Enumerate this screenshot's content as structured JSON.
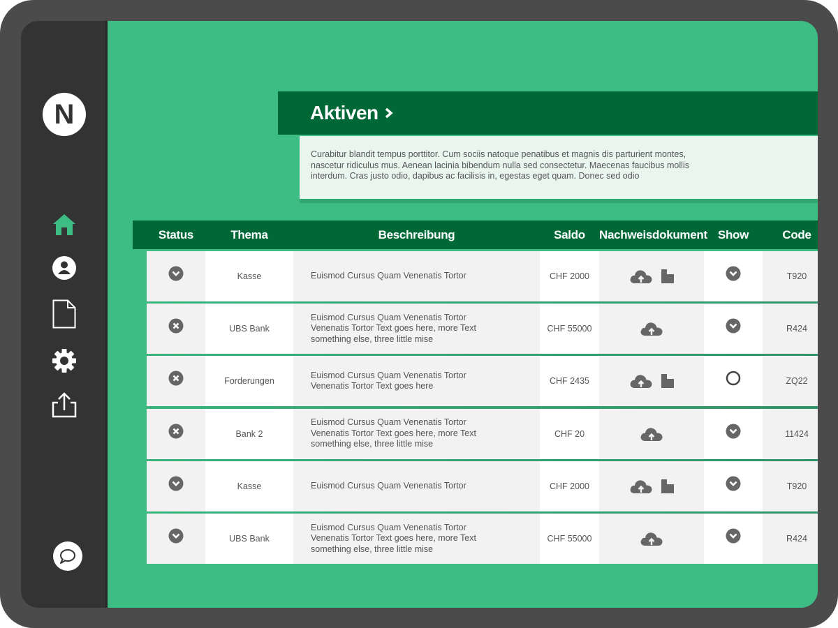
{
  "sidebar": {
    "logo_letter": "N",
    "items": [
      {
        "icon": "home-icon",
        "active": true
      },
      {
        "icon": "user-icon",
        "active": false
      },
      {
        "icon": "document-icon",
        "active": false
      },
      {
        "icon": "gear-icon",
        "active": false
      },
      {
        "icon": "share-icon",
        "active": false
      }
    ],
    "chat_icon": "chat-icon"
  },
  "header": {
    "title": "Aktiven",
    "description": "Curabitur blandit tempus porttitor. Cum sociis natoque penatibus et magnis dis parturient montes, nascetur ridiculus mus. Aenean lacinia bibendum nulla sed consectetur. Maecenas faucibus mollis interdum. Cras justo odio, dapibus ac facilisis in, egestas eget quam. Donec sed odio"
  },
  "table": {
    "columns": [
      "Status",
      "Thema",
      "Beschreibung",
      "Saldo",
      "Nachweisdokument",
      "Show",
      "Code"
    ],
    "rows": [
      {
        "status": "chevron",
        "thema": "Kasse",
        "beschreibung": "Euismod Cursus Quam Venenatis Tortor",
        "saldo": "CHF 2000",
        "docs": [
          "upload",
          "file"
        ],
        "show": "chevron",
        "code": "T920"
      },
      {
        "status": "close",
        "thema": "UBS Bank",
        "beschreibung": "Euismod Cursus Quam Venenatis Tortor Venenatis Tortor Text goes here, more Text something else, three little mise",
        "saldo": "CHF 55000",
        "docs": [
          "upload"
        ],
        "show": "chevron",
        "code": "R424"
      },
      {
        "status": "close",
        "thema": "Forderungen",
        "beschreibung": "Euismod Cursus Quam Venenatis Tortor Venenatis Tortor Text goes here",
        "saldo": "CHF 2435",
        "docs": [
          "upload",
          "file"
        ],
        "show": "ring",
        "code": "ZQ22"
      },
      {
        "status": "close",
        "thema": "Bank 2",
        "beschreibung": "Euismod Cursus Quam Venenatis Tortor Venenatis Tortor Text goes here, more Text something else, three little mise",
        "saldo": "CHF 20",
        "docs": [
          "upload"
        ],
        "show": "chevron",
        "code": "11424"
      },
      {
        "status": "chevron",
        "thema": "Kasse",
        "beschreibung": "Euismod Cursus Quam Venenatis Tortor",
        "saldo": "CHF 2000",
        "docs": [
          "upload",
          "file"
        ],
        "show": "chevron",
        "code": "T920"
      },
      {
        "status": "chevron",
        "thema": "UBS Bank",
        "beschreibung": "Euismod Cursus Quam Venenatis Tortor Venenatis Tortor Text goes here, more Text something else, three little mise",
        "saldo": "CHF 55000",
        "docs": [
          "upload"
        ],
        "show": "chevron",
        "code": "R424"
      }
    ]
  },
  "colors": {
    "background": "#3dbd84",
    "dark_green": "#006837",
    "sidebar": "#333333",
    "active_icon": "#3dbd84",
    "icon_grey": "#666666"
  }
}
